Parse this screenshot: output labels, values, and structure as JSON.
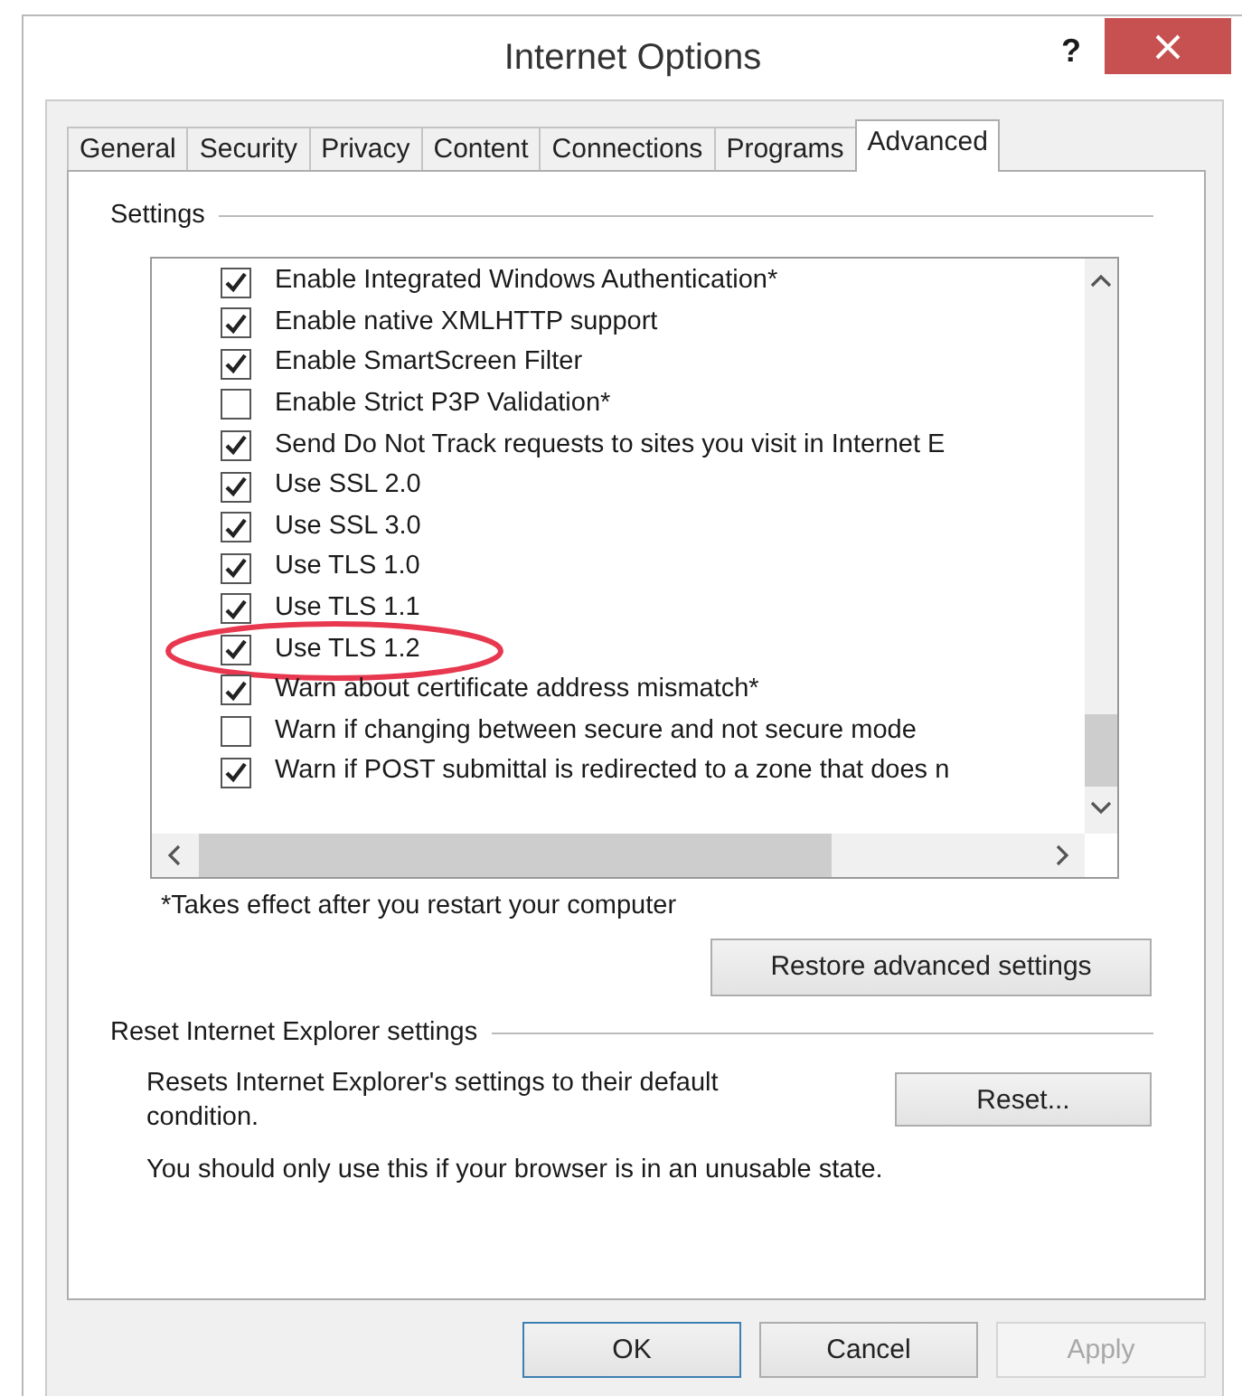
{
  "window": {
    "title": "Internet Options",
    "help": "?"
  },
  "tabs": [
    {
      "label": "General",
      "selected": false
    },
    {
      "label": "Security",
      "selected": false
    },
    {
      "label": "Privacy",
      "selected": false
    },
    {
      "label": "Content",
      "selected": false
    },
    {
      "label": "Connections",
      "selected": false
    },
    {
      "label": "Programs",
      "selected": false
    },
    {
      "label": "Advanced",
      "selected": true
    }
  ],
  "settings": {
    "title": "Settings",
    "items": [
      {
        "label": "Enable Integrated Windows Authentication*",
        "checked": true,
        "highlighted": false
      },
      {
        "label": "Enable native XMLHTTP support",
        "checked": true,
        "highlighted": false
      },
      {
        "label": "Enable SmartScreen Filter",
        "checked": true,
        "highlighted": false
      },
      {
        "label": "Enable Strict P3P Validation*",
        "checked": false,
        "highlighted": false
      },
      {
        "label": "Send Do Not Track requests to sites you visit in Internet E",
        "checked": true,
        "highlighted": false
      },
      {
        "label": "Use SSL 2.0",
        "checked": true,
        "highlighted": false
      },
      {
        "label": "Use SSL 3.0",
        "checked": true,
        "highlighted": false
      },
      {
        "label": "Use TLS 1.0",
        "checked": true,
        "highlighted": false
      },
      {
        "label": "Use TLS 1.1",
        "checked": true,
        "highlighted": false
      },
      {
        "label": "Use TLS 1.2",
        "checked": true,
        "highlighted": true
      },
      {
        "label": "Warn about certificate address mismatch*",
        "checked": true,
        "highlighted": false
      },
      {
        "label": "Warn if changing between secure and not secure mode",
        "checked": false,
        "highlighted": false
      },
      {
        "label": "Warn if POST submittal is redirected to a zone that does n",
        "checked": true,
        "highlighted": false
      }
    ],
    "footnote": "*Takes effect after you restart your computer",
    "restore_button": "Restore advanced settings"
  },
  "reset": {
    "title": "Reset Internet Explorer settings",
    "description": "Resets Internet Explorer's settings to their default condition.",
    "button": "Reset...",
    "warning": "You should only use this if your browser is in an unusable state."
  },
  "buttons": [
    {
      "label": "OK",
      "default": true,
      "disabled": false
    },
    {
      "label": "Cancel",
      "default": false,
      "disabled": false
    },
    {
      "label": "Apply",
      "default": false,
      "disabled": true
    }
  ]
}
